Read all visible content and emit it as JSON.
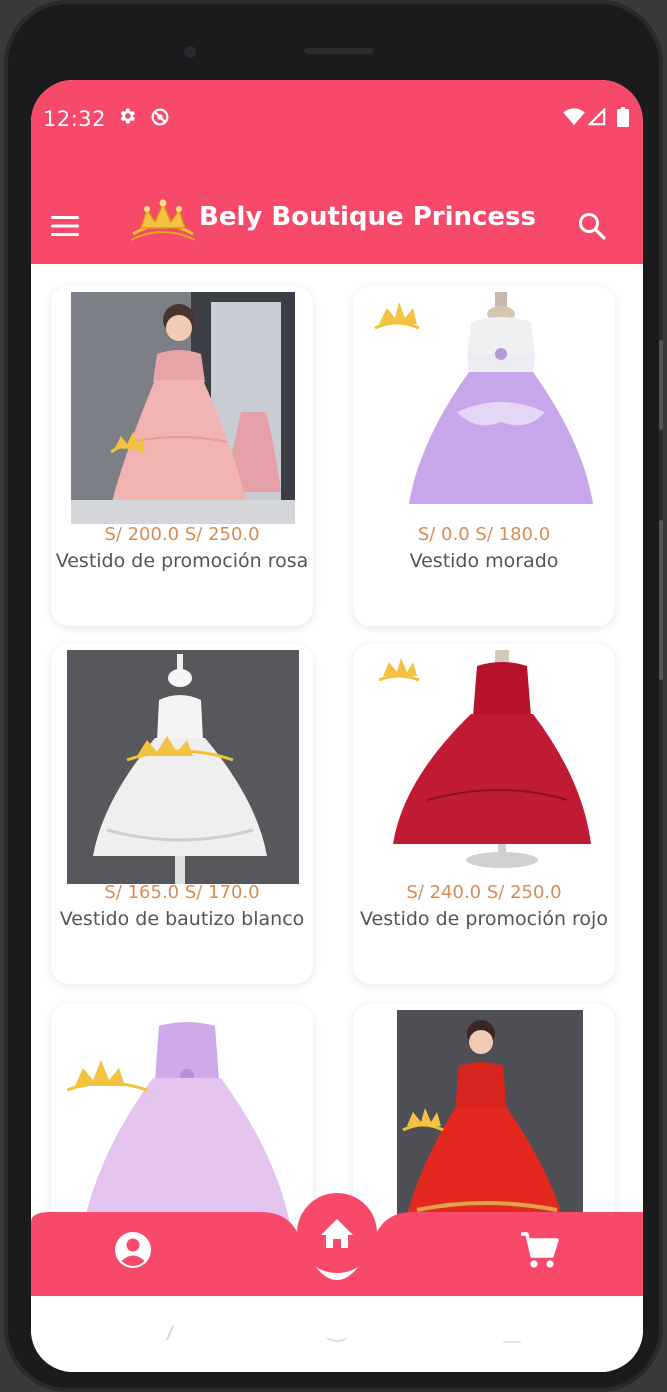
{
  "status_bar": {
    "time": "12:32"
  },
  "app": {
    "title": "Bely Boutique Princess"
  },
  "products": [
    {
      "price_text": "S/ 200.0 S/ 250.0",
      "name": "Vestido de promoción rosa"
    },
    {
      "price_text": "S/ 0.0 S/ 180.0",
      "name": "Vestido morado"
    },
    {
      "price_text": "S/ 165.0 S/ 170.0",
      "name": "Vestido de bautizo blanco"
    },
    {
      "price_text": "S/ 240.0 S/ 250.0",
      "name": "Vestido de promoción rojo"
    }
  ],
  "colors": {
    "primary": "#f74a6b",
    "price": "#d58c57",
    "name_text": "#555555",
    "card_bg": "#ffffff"
  },
  "icons": {
    "menu": "menu-icon",
    "search": "search-icon",
    "profile": "account-circle-icon",
    "home": "home-icon",
    "cart": "cart-icon",
    "settings": "gear-icon"
  }
}
